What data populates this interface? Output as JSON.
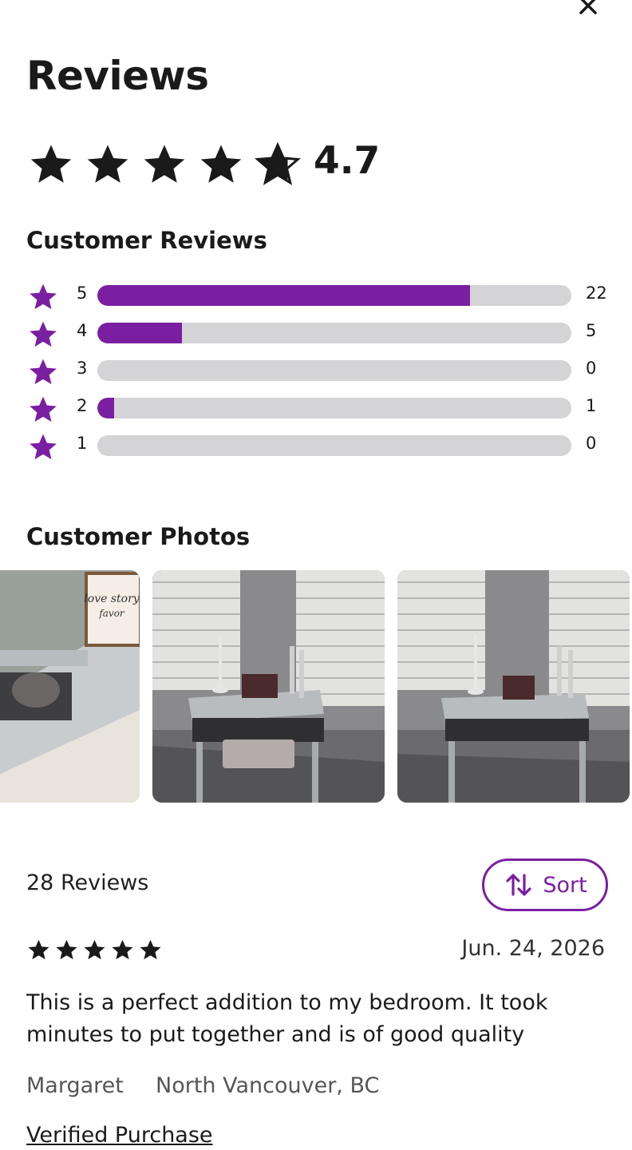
{
  "header": {
    "title": "Reviews",
    "close_icon": "close-icon"
  },
  "summary": {
    "rating": "4.7",
    "stars_filled": 4.7
  },
  "histogram": {
    "title": "Customer Reviews",
    "accent_color": "#7b1fa2",
    "track_color": "#d4d3d6",
    "rows": [
      {
        "stars": "5",
        "count": "22",
        "fraction": 0.786
      },
      {
        "stars": "4",
        "count": "5",
        "fraction": 0.179
      },
      {
        "stars": "3",
        "count": "0",
        "fraction": 0
      },
      {
        "stars": "2",
        "count": "1",
        "fraction": 0.036
      },
      {
        "stars": "1",
        "count": "0",
        "fraction": 0
      }
    ]
  },
  "photos": {
    "title": "Customer Photos",
    "items": [
      {
        "name": "customer-photo-1",
        "wall_text": "Every love story is beautiful but ours is my favorite"
      },
      {
        "name": "customer-photo-2"
      },
      {
        "name": "customer-photo-3"
      }
    ]
  },
  "reviews_header": {
    "count_text": "28 Reviews",
    "sort_label": "Sort",
    "sort_icon": "sort-arrows-icon"
  },
  "review": {
    "stars": 5,
    "date": "Jun. 24, 2026",
    "text": "This is a perfect addition to my bedroom. It took minutes to put together and is of good quality",
    "author": "Margaret",
    "location": "North Vancouver, BC",
    "verified_label": "Verified Purchase"
  }
}
